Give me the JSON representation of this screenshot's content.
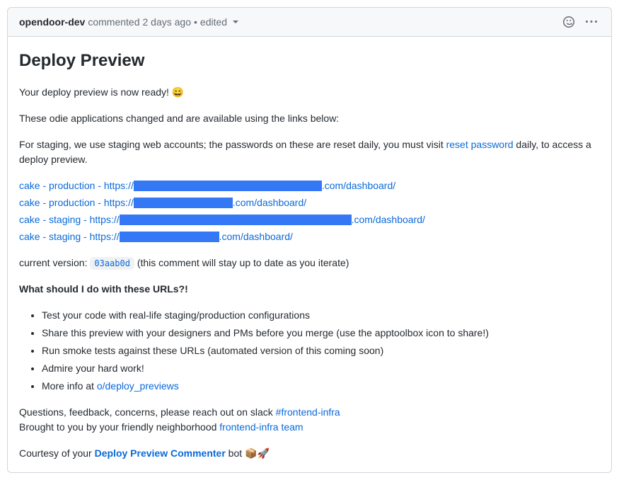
{
  "header": {
    "author": "opendoor-dev",
    "commented": "commented",
    "timestamp": "2 days ago",
    "separator": "•",
    "edited": "edited"
  },
  "body": {
    "title": "Deploy Preview",
    "ready_text": "Your deploy preview is now ready! 😄",
    "changed_text": "These odie applications changed and are available using the links below:",
    "staging_prefix": "For staging, we use staging web accounts; the passwords on these are reset daily, you must visit ",
    "reset_password_link": "reset password",
    "staging_suffix": " daily, to access a deploy preview.",
    "deploy_links": [
      {
        "prefix": "cake - production - https://",
        "suffix": ".com/dashboard/",
        "redact_width": 266
      },
      {
        "prefix": "cake - production - https://",
        "suffix": ".com/dashboard/",
        "redact_width": 140
      },
      {
        "prefix": "cake - staging - https://",
        "suffix": ".com/dashboard/",
        "redact_width": 328
      },
      {
        "prefix": "cake - staging - https://",
        "suffix": ".com/dashboard/",
        "redact_width": 141
      }
    ],
    "version_label": "current version: ",
    "version_code": "03aab0d",
    "version_note": " (this comment will stay up to date as you iterate)",
    "urls_heading": "What should I do with these URLs?!",
    "tips": [
      "Test your code with real-life staging/production configurations",
      "Share this preview with your designers and PMs before you merge (use the apptoolbox icon to share!)",
      "Run smoke tests against these URLs (automated version of this coming soon)",
      "Admire your hard work!"
    ],
    "more_info_prefix": "More info at ",
    "more_info_link": "o/deploy_previews",
    "questions_prefix": "Questions, feedback, concerns, please reach out on slack ",
    "slack_channel": "#frontend-infra",
    "brought_prefix": "Brought to you by your friendly neighborhood ",
    "team_link": "frontend-infra team",
    "courtesy_prefix": "Courtesy of your ",
    "commenter_link": "Deploy Preview Commenter",
    "courtesy_suffix": " bot 📦🚀"
  }
}
